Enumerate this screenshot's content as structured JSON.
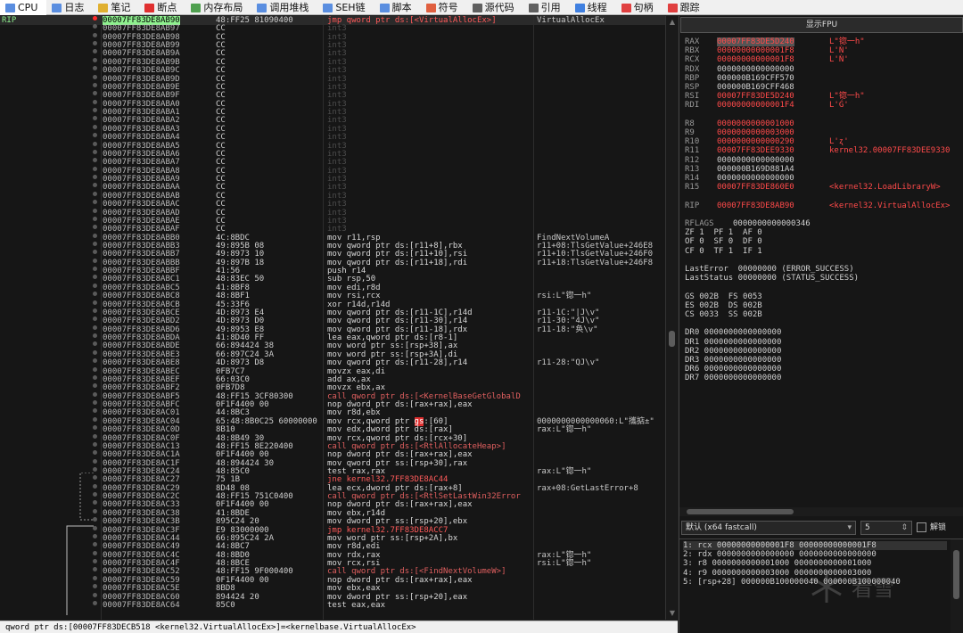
{
  "tabs": [
    {
      "label": "CPU",
      "icon": "cpu-icon",
      "color": "#5a8ee0"
    },
    {
      "label": "日志",
      "icon": "log-icon",
      "color": "#5a8ee0"
    },
    {
      "label": "笔记",
      "icon": "notes-icon",
      "color": "#e0b030"
    },
    {
      "label": "断点",
      "icon": "breakpoint-icon",
      "color": "#e03030"
    },
    {
      "label": "内存布局",
      "icon": "memory-map-icon",
      "color": "#50a050"
    },
    {
      "label": "调用堆栈",
      "icon": "call-stack-icon",
      "color": "#5a8ee0"
    },
    {
      "label": "SEH链",
      "icon": "seh-icon",
      "color": "#5a8ee0"
    },
    {
      "label": "脚本",
      "icon": "script-icon",
      "color": "#5a8ee0"
    },
    {
      "label": "符号",
      "icon": "symbols-icon",
      "color": "#e06040"
    },
    {
      "label": "源代码",
      "icon": "source-icon",
      "color": "#606060"
    },
    {
      "label": "引用",
      "icon": "references-icon",
      "color": "#606060"
    },
    {
      "label": "线程",
      "icon": "threads-icon",
      "color": "#4080e0"
    },
    {
      "label": "句柄",
      "icon": "handles-icon",
      "color": "#e04040"
    },
    {
      "label": "跟踪",
      "icon": "trace-icon",
      "color": "#e04040"
    }
  ],
  "disasm": {
    "rip_label": "RIP",
    "rows": [
      {
        "a": "00007FF83DE8AB90",
        "b": "48:FF25 81090400",
        "i": "jmp qword ptr ds:[<VirtualAllocEx>]",
        "c": "VirtualAllocEx",
        "k": "jmp",
        "cur": true,
        "bp": true
      },
      {
        "a": "00007FF83DE8AB97",
        "b": "CC",
        "i": "int3",
        "k": "pad"
      },
      {
        "a": "00007FF83DE8AB98",
        "b": "CC",
        "i": "int3",
        "k": "pad"
      },
      {
        "a": "00007FF83DE8AB99",
        "b": "CC",
        "i": "int3",
        "k": "pad"
      },
      {
        "a": "00007FF83DE8AB9A",
        "b": "CC",
        "i": "int3",
        "k": "pad"
      },
      {
        "a": "00007FF83DE8AB9B",
        "b": "CC",
        "i": "int3",
        "k": "pad"
      },
      {
        "a": "00007FF83DE8AB9C",
        "b": "CC",
        "i": "int3",
        "k": "pad"
      },
      {
        "a": "00007FF83DE8AB9D",
        "b": "CC",
        "i": "int3",
        "k": "pad"
      },
      {
        "a": "00007FF83DE8AB9E",
        "b": "CC",
        "i": "int3",
        "k": "pad"
      },
      {
        "a": "00007FF83DE8AB9F",
        "b": "CC",
        "i": "int3",
        "k": "pad"
      },
      {
        "a": "00007FF83DE8ABA0",
        "b": "CC",
        "i": "int3",
        "k": "pad"
      },
      {
        "a": "00007FF83DE8ABA1",
        "b": "CC",
        "i": "int3",
        "k": "pad"
      },
      {
        "a": "00007FF83DE8ABA2",
        "b": "CC",
        "i": "int3",
        "k": "pad"
      },
      {
        "a": "00007FF83DE8ABA3",
        "b": "CC",
        "i": "int3",
        "k": "pad"
      },
      {
        "a": "00007FF83DE8ABA4",
        "b": "CC",
        "i": "int3",
        "k": "pad"
      },
      {
        "a": "00007FF83DE8ABA5",
        "b": "CC",
        "i": "int3",
        "k": "pad"
      },
      {
        "a": "00007FF83DE8ABA6",
        "b": "CC",
        "i": "int3",
        "k": "pad"
      },
      {
        "a": "00007FF83DE8ABA7",
        "b": "CC",
        "i": "int3",
        "k": "pad"
      },
      {
        "a": "00007FF83DE8ABA8",
        "b": "CC",
        "i": "int3",
        "k": "pad"
      },
      {
        "a": "00007FF83DE8ABA9",
        "b": "CC",
        "i": "int3",
        "k": "pad"
      },
      {
        "a": "00007FF83DE8ABAA",
        "b": "CC",
        "i": "int3",
        "k": "pad"
      },
      {
        "a": "00007FF83DE8ABAB",
        "b": "CC",
        "i": "int3",
        "k": "pad"
      },
      {
        "a": "00007FF83DE8ABAC",
        "b": "CC",
        "i": "int3",
        "k": "pad"
      },
      {
        "a": "00007FF83DE8ABAD",
        "b": "CC",
        "i": "int3",
        "k": "pad"
      },
      {
        "a": "00007FF83DE8ABAE",
        "b": "CC",
        "i": "int3",
        "k": "pad"
      },
      {
        "a": "00007FF83DE8ABAF",
        "b": "CC",
        "i": "int3",
        "k": "pad"
      },
      {
        "a": "00007FF83DE8ABB0",
        "b": "4C:8BDC",
        "i": "mov r11,rsp",
        "c": "FindNextVolumeA"
      },
      {
        "a": "00007FF83DE8ABB3",
        "b": "49:895B 08",
        "i": "mov qword ptr ds:[r11+8],rbx",
        "c": "r11+08:TlsGetValue+246E8"
      },
      {
        "a": "00007FF83DE8ABB7",
        "b": "49:8973 10",
        "i": "mov qword ptr ds:[r11+10],rsi",
        "c": "r11+10:TlsGetValue+246F0"
      },
      {
        "a": "00007FF83DE8ABBB",
        "b": "49:897B 18",
        "i": "mov qword ptr ds:[r11+18],rdi",
        "c": "r11+18:TlsGetValue+246F8"
      },
      {
        "a": "00007FF83DE8ABBF",
        "b": "41:56",
        "i": "push r14"
      },
      {
        "a": "00007FF83DE8ABC1",
        "b": "48:83EC 50",
        "i": "sub rsp,50"
      },
      {
        "a": "00007FF83DE8ABC5",
        "b": "41:8BF8",
        "i": "mov edi,r8d"
      },
      {
        "a": "00007FF83DE8ABC8",
        "b": "48:8BF1",
        "i": "mov rsi,rcx",
        "c": "rsi:L\"锪一h\""
      },
      {
        "a": "00007FF83DE8ABCB",
        "b": "45:33F6",
        "i": "xor r14d,r14d"
      },
      {
        "a": "00007FF83DE8ABCE",
        "b": "4D:8973 E4",
        "i": "mov qword ptr ds:[r11-1C],r14d",
        "c": "r11-1C:\"|J\\v\""
      },
      {
        "a": "00007FF83DE8ABD2",
        "b": "4D:8973 D0",
        "i": "mov qword ptr ds:[r11-30],r14",
        "c": "r11-30:\"4J\\v\""
      },
      {
        "a": "00007FF83DE8ABD6",
        "b": "49:8953 E8",
        "i": "mov qword ptr ds:[r11-18],rdx",
        "c": "r11-18:\"奂\\v\""
      },
      {
        "a": "00007FF83DE8ABDA",
        "b": "41:8D40 FF",
        "i": "lea eax,qword ptr ds:[r8-1]"
      },
      {
        "a": "00007FF83DE8ABDE",
        "b": "66:894424 38",
        "i": "mov word ptr ss:[rsp+38],ax"
      },
      {
        "a": "00007FF83DE8ABE3",
        "b": "66:897C24 3A",
        "i": "mov word ptr ss:[rsp+3A],di"
      },
      {
        "a": "00007FF83DE8ABE8",
        "b": "4D:8973 D8",
        "i": "mov qword ptr ds:[r11-28],r14",
        "c": "r11-28:\"QJ\\v\""
      },
      {
        "a": "00007FF83DE8ABEC",
        "b": "0FB7C7",
        "i": "movzx eax,di"
      },
      {
        "a": "00007FF83DE8ABEF",
        "b": "66:03C0",
        "i": "add ax,ax"
      },
      {
        "a": "00007FF83DE8ABF2",
        "b": "0FB7D8",
        "i": "movzx ebx,ax"
      },
      {
        "a": "00007FF83DE8ABF5",
        "b": "48:FF15 3CF80300",
        "i": "call qword ptr ds:[<KernelBaseGetGlobalD",
        "k": "call"
      },
      {
        "a": "00007FF83DE8ABFC",
        "b": "0F1F4400 00",
        "i": "nop dword ptr ds:[rax+rax],eax"
      },
      {
        "a": "00007FF83DE8AC01",
        "b": "44:8BC3",
        "i": "mov r8d,ebx"
      },
      {
        "a": "00007FF83DE8AC04",
        "b": "65:48:8B0C25 60000000",
        "i": "mov rcx,qword ptr gs:[60]",
        "c": "0000000000000060:L\"攜掂±\"",
        "gs": true
      },
      {
        "a": "00007FF83DE8AC0D",
        "b": "8B10",
        "i": "mov edx,dword ptr ds:[rax]",
        "c": "rax:L\"锪一h\""
      },
      {
        "a": "00007FF83DE8AC0F",
        "b": "48:8B49 30",
        "i": "mov rcx,qword ptr ds:[rcx+30]"
      },
      {
        "a": "00007FF83DE8AC13",
        "b": "48:FF15 8E220400",
        "i": "call qword ptr ds:[<RtlAllocateHeap>]",
        "k": "call"
      },
      {
        "a": "00007FF83DE8AC1A",
        "b": "0F1F4400 00",
        "i": "nop dword ptr ds:[rax+rax],eax"
      },
      {
        "a": "00007FF83DE8AC1F",
        "b": "48:894424 30",
        "i": "mov qword ptr ss:[rsp+30],rax"
      },
      {
        "a": "00007FF83DE8AC24",
        "b": "48:85C0",
        "i": "test rax,rax",
        "c": "rax:L\"锪一h\""
      },
      {
        "a": "00007FF83DE8AC27",
        "b": "75 1B",
        "i": "jne kernel32.7FF83DE8AC44",
        "k": "jcc"
      },
      {
        "a": "00007FF83DE8AC29",
        "b": "8D48 08",
        "i": "lea ecx,dword ptr ds:[rax+8]",
        "c": "rax+08:GetLastError+8"
      },
      {
        "a": "00007FF83DE8AC2C",
        "b": "48:FF15 751C0400",
        "i": "call qword ptr ds:[<RtlSetLastWin32Error",
        "k": "call"
      },
      {
        "a": "00007FF83DE8AC33",
        "b": "0F1F4400 00",
        "i": "nop dword ptr ds:[rax+rax],eax"
      },
      {
        "a": "00007FF83DE8AC38",
        "b": "41:8BDE",
        "i": "mov ebx,r14d"
      },
      {
        "a": "00007FF83DE8AC3B",
        "b": "895C24 20",
        "i": "mov dword ptr ss:[rsp+20],ebx"
      },
      {
        "a": "00007FF83DE8AC3F",
        "b": "E9 83000000",
        "i": "jmp kernel32.7FF83DE8ACC7",
        "k": "jmp"
      },
      {
        "a": "00007FF83DE8AC44",
        "b": "66:895C24 2A",
        "i": "mov word ptr ss:[rsp+2A],bx"
      },
      {
        "a": "00007FF83DE8AC49",
        "b": "44:8BC7",
        "i": "mov r8d,edi"
      },
      {
        "a": "00007FF83DE8AC4C",
        "b": "48:8BD0",
        "i": "mov rdx,rax",
        "c": "rax:L\"锪一h\""
      },
      {
        "a": "00007FF83DE8AC4F",
        "b": "48:8BCE",
        "i": "mov rcx,rsi",
        "c": "rsi:L\"锪一h\""
      },
      {
        "a": "00007FF83DE8AC52",
        "b": "48:FF15 9F000400",
        "i": "call qword ptr ds:[<FindNextVolumeW>]",
        "k": "call"
      },
      {
        "a": "00007FF83DE8AC59",
        "b": "0F1F4400 00",
        "i": "nop dword ptr ds:[rax+rax],eax"
      },
      {
        "a": "00007FF83DE8AC5E",
        "b": "8BD8",
        "i": "mov ebx,eax"
      },
      {
        "a": "00007FF83DE8AC60",
        "b": "894424 20",
        "i": "mov dword ptr ss:[rsp+20],eax"
      },
      {
        "a": "00007FF83DE8AC64",
        "b": "85C0",
        "i": "test eax,eax"
      }
    ]
  },
  "statusbar": "qword ptr ds:[00007FF83DECB518 <kernel32.VirtualAllocEx>]=<kernelbase.VirtualAllocEx>",
  "fpu_button": "显示FPU",
  "registers": [
    {
      "n": "RAX",
      "v": "00007FF83DE5D240",
      "c": "L\"锪一h\"",
      "chg": true,
      "sel": true
    },
    {
      "n": "RBX",
      "v": "00000000000001F8",
      "c": "L'Ǹ'",
      "chg": true
    },
    {
      "n": "RCX",
      "v": "00000000000001F8",
      "c": "L'Ǹ'",
      "chg": true
    },
    {
      "n": "RDX",
      "v": "0000000000000000"
    },
    {
      "n": "RBP",
      "v": "000000B169CFF570"
    },
    {
      "n": "RSP",
      "v": "000000B169CFF468"
    },
    {
      "n": "RSI",
      "v": "00007FF83DE5D240",
      "c": "L\"锪一h\"",
      "chg": true
    },
    {
      "n": "RDI",
      "v": "00000000000001F4",
      "c": "L'Ǵ'",
      "chg": true
    },
    {
      "gap": true
    },
    {
      "n": "R8",
      "v": "0000000000001000",
      "chg": true
    },
    {
      "n": "R9",
      "v": "0000000000003000",
      "chg": true
    },
    {
      "n": "R10",
      "v": "0000000000000290",
      "c": "L'ʐ'",
      "chg": true
    },
    {
      "n": "R11",
      "v": "00007FF83DEE9330",
      "c": "kernel32.00007FF83DEE9330",
      "chg": true
    },
    {
      "n": "R12",
      "v": "0000000000000000"
    },
    {
      "n": "R13",
      "v": "000000B169D881A4"
    },
    {
      "n": "R14",
      "v": "0000000000000000"
    },
    {
      "n": "R15",
      "v": "00007FF83DE860E0",
      "c": "<kernel32.LoadLibraryW>",
      "chg": true
    },
    {
      "gap": true
    },
    {
      "n": "RIP",
      "v": "00007FF83DE8AB90",
      "c": "<kernel32.VirtualAllocEx>",
      "chg": true
    },
    {
      "gap": true
    },
    {
      "n": "RFLAGS",
      "v": "0000000000000346",
      "w": true
    },
    {
      "f": "ZF 1  PF 1  AF 0"
    },
    {
      "f": "OF 0  SF 0  DF 0"
    },
    {
      "f": "CF 0  TF 1  IF 1"
    },
    {
      "gap": true
    },
    {
      "f": "LastError  00000000 (ERROR_SUCCESS)"
    },
    {
      "f": "LastStatus 00000000 (STATUS_SUCCESS)"
    },
    {
      "gap": true
    },
    {
      "f": "GS 002B  FS 0053"
    },
    {
      "f": "ES 002B  DS 002B"
    },
    {
      "f": "CS 0033  SS 002B"
    },
    {
      "gap": true
    },
    {
      "f": "DR0 0000000000000000"
    },
    {
      "f": "DR1 0000000000000000"
    },
    {
      "f": "DR2 0000000000000000"
    },
    {
      "f": "DR3 0000000000000000"
    },
    {
      "f": "DR6 0000000000000000"
    },
    {
      "f": "DR7 0000000000000000"
    }
  ],
  "callconv": {
    "selected": "默认 (x64 fastcall)",
    "argcount": "5",
    "unlock_label": "解锁"
  },
  "args": [
    "1: rcx 00000000000001F8 00000000000001F8",
    "2: rdx 0000000000000000 0000000000000000",
    "3: r8 0000000000001000 0000000000001000",
    "4: r9 0000000000003000 0000000000003000",
    "5: [rsp+28] 000000B100000040 000000B100000040"
  ],
  "watermark": "看雪"
}
